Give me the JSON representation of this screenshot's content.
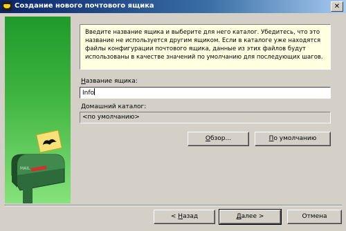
{
  "window": {
    "title": "Создание нового почтового ящика"
  },
  "intro": {
    "text": "Введите название ящика и выберите для него каталог. Убедитесь, что это название не используется другим ящиком. Если в каталоге уже находятся файлы конфигурации почтового ящика, данные из этих файлов будут использованы в качестве значений по умолчанию для последующих шагов."
  },
  "mailbox_name": {
    "label_underlined": "Н",
    "label_rest": "азвание ящика:",
    "value": "Info"
  },
  "home_dir": {
    "label": "Домашний каталог:",
    "value": "<по умолчанию>"
  },
  "buttons": {
    "browse_underlined": "О",
    "browse_rest": "бзор...",
    "default_underlined": "П",
    "default_rest": "о умолчанию",
    "back_prefix": "<  ",
    "back_underlined": "Н",
    "back_rest": "азад",
    "next_underlined": "Д",
    "next_rest": "алее  >",
    "cancel": "Отмена"
  },
  "side_image": {
    "mailbox_text": "MAIL",
    "icon": "mailbox-with-bat-stamp"
  },
  "colors": {
    "intro_bg": "#ffffe1",
    "side_top": "#1f9a2b",
    "side_bottom": "#86e27c",
    "titlebar": "#0a246a"
  }
}
